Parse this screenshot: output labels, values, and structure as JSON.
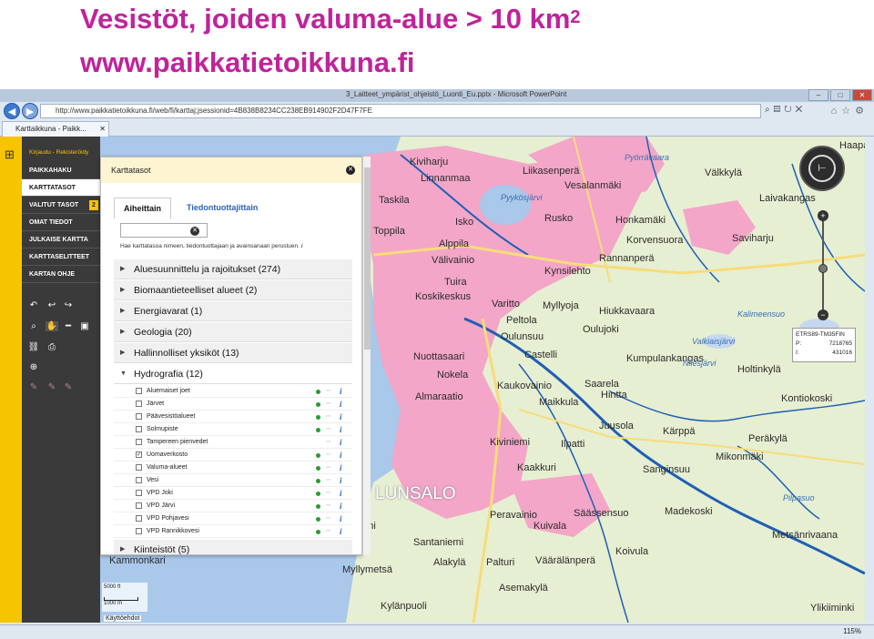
{
  "slide": {
    "title": "Vesistöt, joiden valuma-alue > 10 km",
    "title_superscript": "2",
    "url": "www.paikkatietoikkuna.fi"
  },
  "browser": {
    "window_title": "3_Laitteet_ympärist_ohjeistö_Luonti_Eu.pptx - Microsoft PowerPoint",
    "address": "http://www.paikkatietoikkuna.fi/web/fi/karttaj;jsessionid=4B838B8234CC238EB914902F2D47F7FE",
    "address_host": "paikkatietoikkuna.fi",
    "tab_title": "Karttaikkuna - Paikk...",
    "zoom_level": "115%"
  },
  "menu": {
    "login_link": "Kirjaudu - Rekisteröidy",
    "items": [
      {
        "label": "PAIKKAHAKU"
      },
      {
        "label": "KARTTATASOT"
      },
      {
        "label": "VALITUT TASOT",
        "badge": "2"
      },
      {
        "label": "OMAT TIEDOT"
      },
      {
        "label": "JULKAISE KARTTA"
      },
      {
        "label": "KARTTASELITTEET"
      },
      {
        "label": "KARTAN OHJE"
      }
    ]
  },
  "panel": {
    "title": "Karttatasot",
    "tabs": [
      "Aiheittain",
      "Tiedontuottajittain"
    ],
    "search_value": "",
    "search_hint": "Hae karttatasoa nimeen, tiedontuottajaan ja avainsanaan perustuen.",
    "categories": [
      {
        "label": "Aluesuunnittelu ja rajoitukset (274)"
      },
      {
        "label": "Biomaantieteelliset alueet (2)"
      },
      {
        "label": "Energiavarat (1)"
      },
      {
        "label": "Geologia (20)"
      },
      {
        "label": "Hallinnolliset yksiköt (13)"
      },
      {
        "label": "Hydrografia (12)"
      }
    ],
    "hydro_items": [
      {
        "label": "Aluemaiset joet",
        "checked": false
      },
      {
        "label": "Järvet",
        "checked": false
      },
      {
        "label": "Päävesistöalueet",
        "checked": false
      },
      {
        "label": "Solmupiste",
        "checked": false
      },
      {
        "label": "Tampereen pienvedet",
        "checked": false
      },
      {
        "label": "Uomaverkosto",
        "checked": true
      },
      {
        "label": "Valuma-alueet",
        "checked": false
      },
      {
        "label": "Vesi",
        "checked": false
      },
      {
        "label": "VPD Joki",
        "checked": false
      },
      {
        "label": "VPD Järvi",
        "checked": false
      },
      {
        "label": "VPD Pohjavesi",
        "checked": false
      },
      {
        "label": "VPD Rannikkovesi",
        "checked": false
      }
    ],
    "next_category": "Kiinteistöt (5)"
  },
  "map": {
    "places": [
      "Kiviharju",
      "Linnanmaa",
      "Taskila",
      "Isko",
      "Toppila",
      "Alppila",
      "Välivainio",
      "Tuira",
      "Koskikeskus",
      "Pyykösjärvi",
      "Rusko",
      "Liikasenperä",
      "Vesalanmäki",
      "Honkamäki",
      "Korvensuora",
      "Saviharju",
      "Rannanperä",
      "Kynsilehto",
      "Myllyoja",
      "Hiukkavaara",
      "Oulujoki",
      "Peltola",
      "Oulunsuu",
      "Varitto",
      "Castelli",
      "Nuottasaari",
      "Nokela",
      "Kaukovainio",
      "Maikkula",
      "Almaraatio",
      "Saarela",
      "Kumpulankangas",
      "Hintta",
      "Juusola",
      "Kärppä",
      "Ilpatti",
      "Kiviniemi",
      "Kaakkuri",
      "Sanginsuu",
      "Mikonmäki",
      "Peräkylä",
      "Madekoski",
      "Peravainio",
      "Kuivala",
      "Säässensuo",
      "Santaniemi",
      "Alakylä",
      "Palturi",
      "Väärälänperä",
      "Koivula",
      "Myllymetsä",
      "Asemakylä",
      "Kylänpuoli",
      "Orni",
      "Kammonkari",
      "Holtinkylä",
      "Kontiokoski",
      "Metsänrivaana",
      "Välkkylä",
      "Laivakangas",
      "Haapa",
      "Pyörrävaara",
      "Kalimeensuo",
      "Valkiaisjärvi",
      "Nilesjärvi",
      "Pilpasuo",
      "Ylikiiminki"
    ],
    "big_label": "LUNSALO",
    "crs": "ETRS89-TM35FIN",
    "coord_p_label": "P:",
    "coord_p": "7218765",
    "coord_i_label": "I:",
    "coord_i": "431016",
    "scale_top": "5000 ft",
    "scale_label": "1000 m",
    "terms": "Käyttöehdot",
    "colors": {
      "urban": "#f3a6c8",
      "land": "#e6efd2",
      "water": "#a9c8ea",
      "river": "#1f5fb5",
      "road_major": "#f7dc7a"
    }
  }
}
